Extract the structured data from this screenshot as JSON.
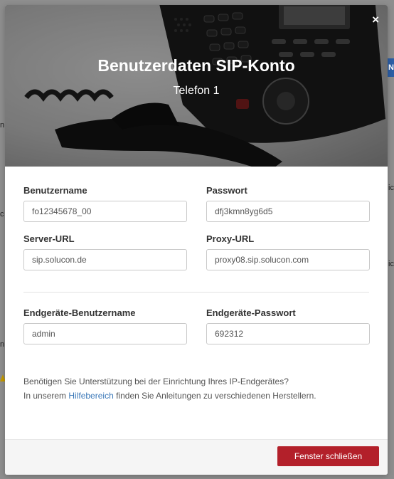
{
  "background": {
    "fragments": [
      "n",
      "c",
      "ic",
      "ic",
      "n"
    ],
    "tag": "N"
  },
  "modal": {
    "title": "Benutzerdaten SIP-Konto",
    "subtitle": "Telefon 1",
    "close_icon": "×"
  },
  "fields": {
    "username": {
      "label": "Benutzername",
      "value": "fo12345678_00"
    },
    "password": {
      "label": "Passwort",
      "value": "dfj3kmn8yg6d5"
    },
    "server_url": {
      "label": "Server-URL",
      "value": "sip.solucon.de"
    },
    "proxy_url": {
      "label": "Proxy-URL",
      "value": "proxy08.sip.solucon.com"
    },
    "device_username": {
      "label": "Endgeräte-Benutzername",
      "value": "admin"
    },
    "device_password": {
      "label": "Endgeräte-Passwort",
      "value": "692312"
    }
  },
  "help": {
    "line1": "Benötigen Sie Unterstützung bei der Einrichtung Ihres IP-Endgerätes?",
    "prefix": "In unserem",
    "link": "Hilfebereich",
    "suffix": "finden Sie Anleitungen zu verschiedenen Herstellern."
  },
  "footer": {
    "close_button": "Fenster schließen"
  },
  "colors": {
    "accent": "#b3202a",
    "link": "#3b78b8"
  },
  "icons": {
    "close": "close-icon",
    "hero": "desk-phone-image"
  }
}
